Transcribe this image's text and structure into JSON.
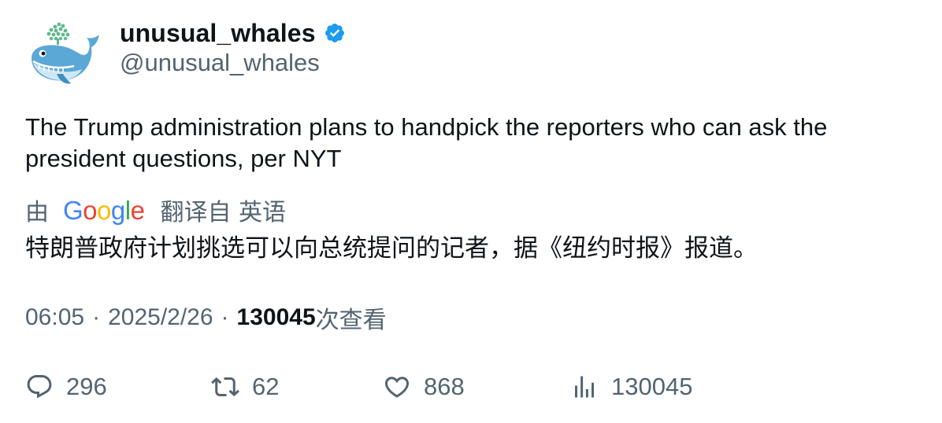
{
  "author": {
    "display_name": "unusual_whales",
    "handle": "@unusual_whales",
    "verified_color": "#1d9bf0"
  },
  "tweet": {
    "text": "The Trump administration plans to handpick the reporters who can ask the president questions, per NYT"
  },
  "translation": {
    "by_label": "由",
    "provider": "Google",
    "from_label": "翻译自 英语",
    "text": "特朗普政府计划挑选可以向总统提问的记者，据《纽约时报》报道。"
  },
  "meta": {
    "time": "06:05",
    "separator": "·",
    "date": "2025/2/26",
    "views_count": "130045",
    "views_label": "次查看"
  },
  "actions": {
    "replies": "296",
    "retweets": "62",
    "likes": "868",
    "views": "130045"
  },
  "colors": {
    "text_primary": "#0f1419",
    "text_secondary": "#536471",
    "whale_blue": "#5ba8d6",
    "spout_green": "#5fb98b"
  }
}
